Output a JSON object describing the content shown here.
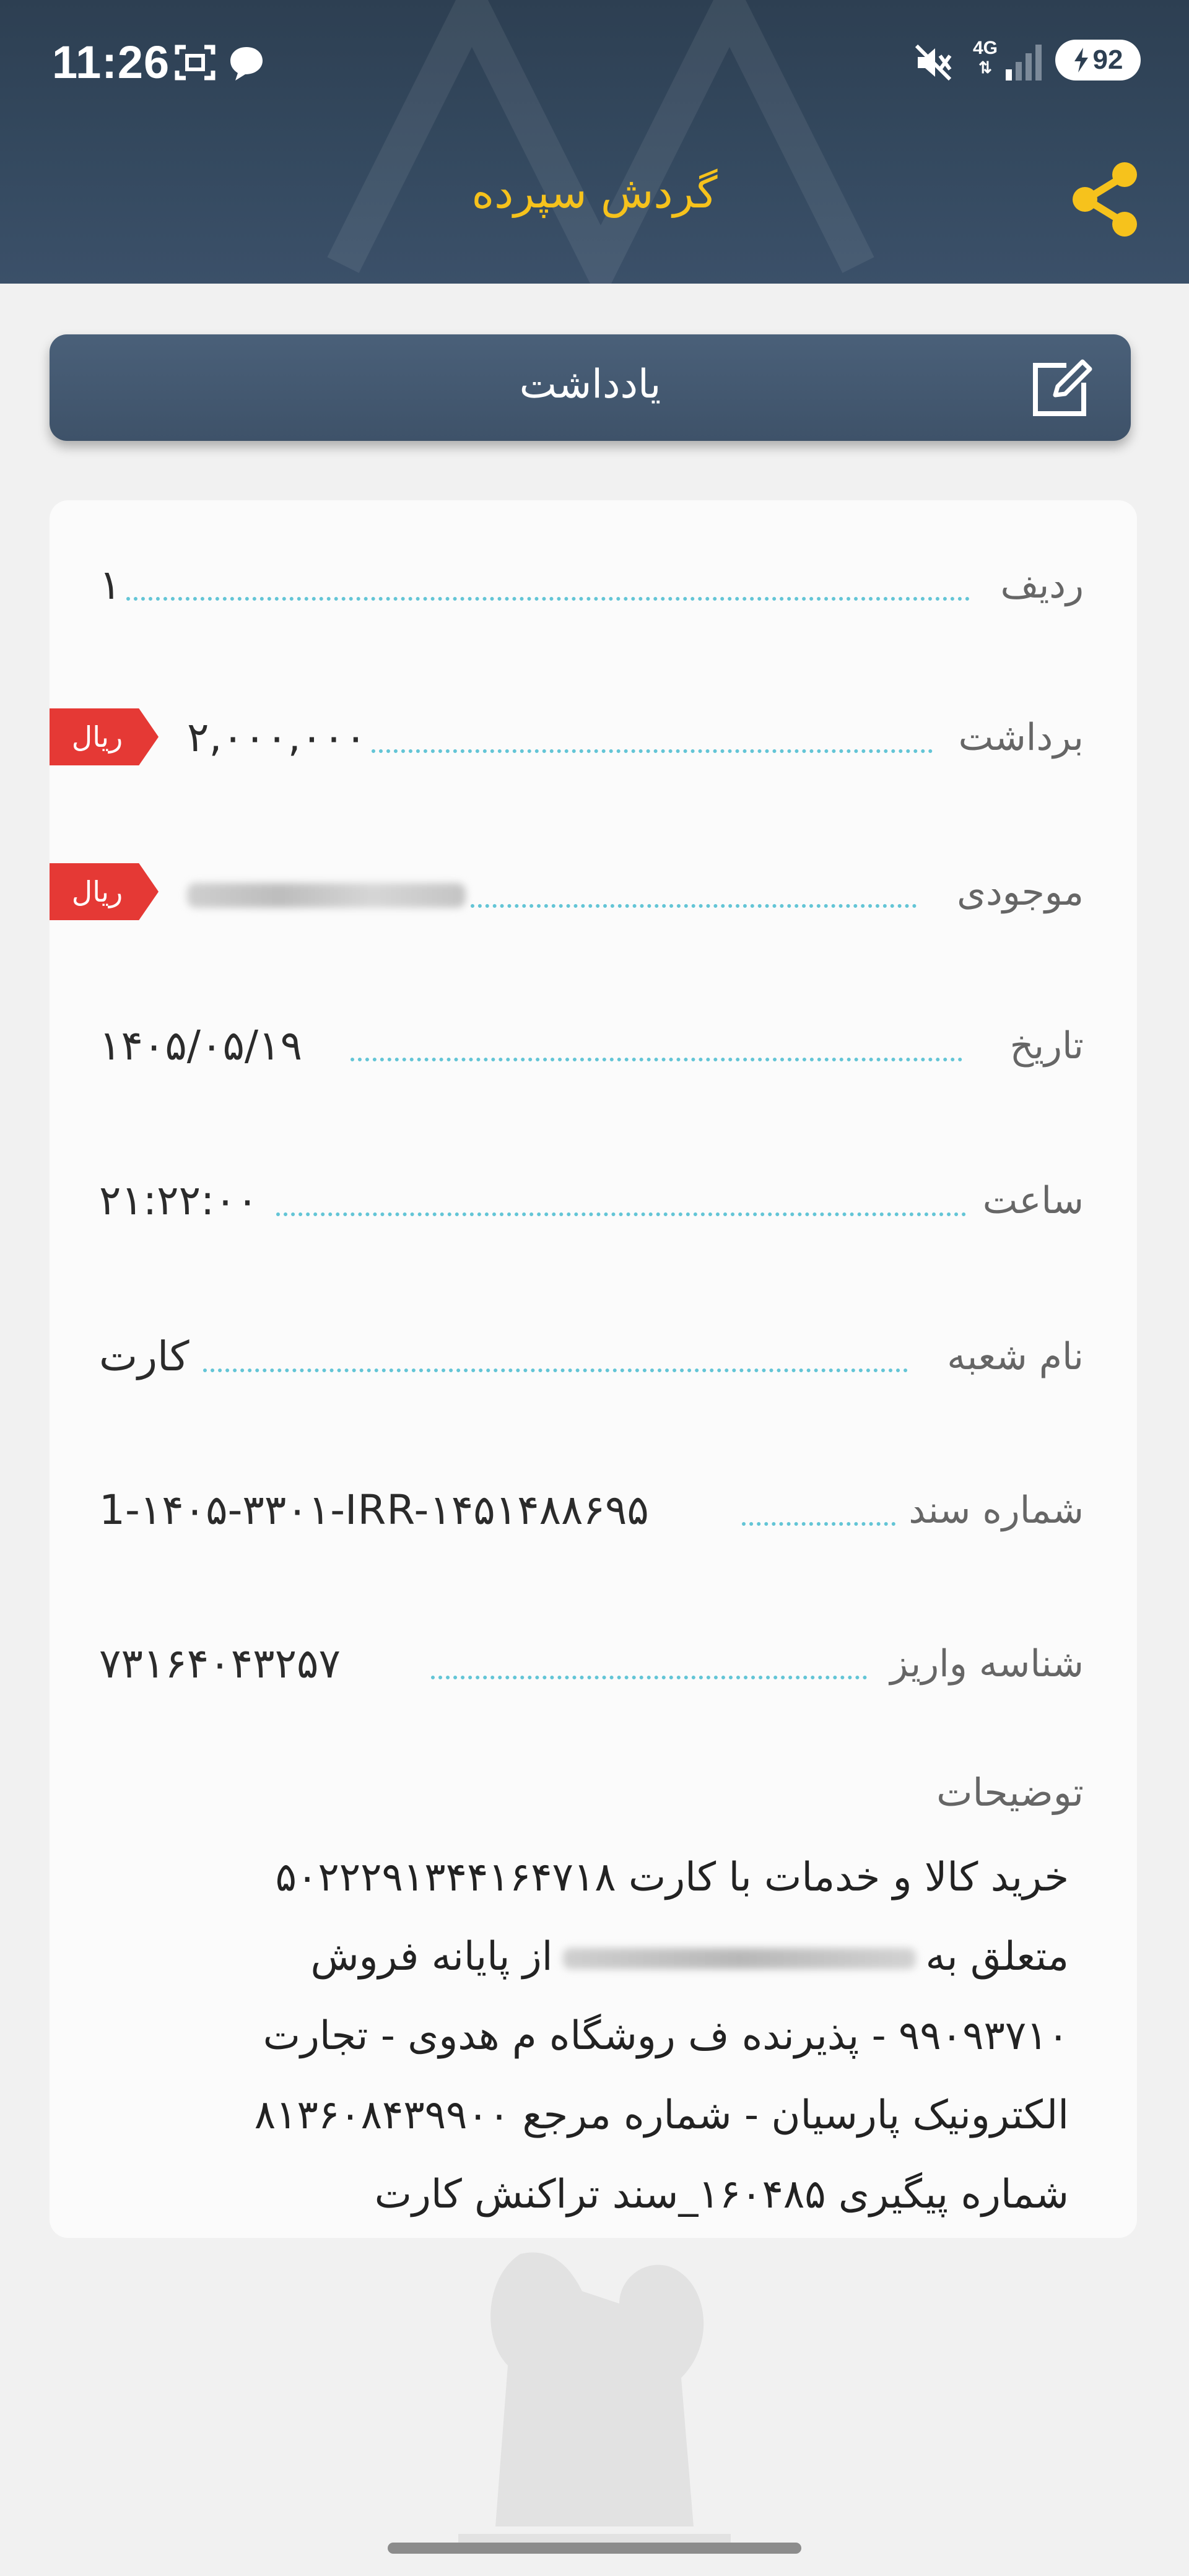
{
  "status_bar": {
    "time": "11:26",
    "network": "4G",
    "battery": "92",
    "icons": [
      "screenshot-icon",
      "chat-icon",
      "mute-icon",
      "signal-icon",
      "charging-icon"
    ]
  },
  "header": {
    "title": "گردش سپرده",
    "share_icon": "share-icon"
  },
  "note_button": {
    "label": "یادداشت",
    "icon": "edit-icon"
  },
  "details": {
    "currency_badge": "ریال",
    "rows": [
      {
        "label": "ردیف",
        "value": "۱"
      },
      {
        "label": "برداشت",
        "value": "۲,۰۰۰,۰۰۰",
        "currency": "ریال"
      },
      {
        "label": "موجودی",
        "value": "",
        "currency": "ریال",
        "redacted": true
      },
      {
        "label": "تاریخ",
        "value": "۱۴۰۵/۰۵/۱۹"
      },
      {
        "label": "ساعت",
        "value": "۲۱:۲۲:۰۰"
      },
      {
        "label": "نام شعبه",
        "value": "کارت"
      },
      {
        "label": "شماره سند",
        "value": "1-۱۴۰۵-۳۳۰۱-IRR-۱۴۵۱۴۸۸۶۹۵"
      },
      {
        "label": "شناسه واریز",
        "value": "۷۳۱۶۴۰۴۳۲۵۷"
      }
    ],
    "description_label": "توضیحات",
    "description_lines": [
      "خرید کالا و خدمات با کارت ۵۰۲۲۲۹۱۳۴۴۱۶۴۷۱۸",
      "متعلق به",
      "از پایانه فروش",
      "۹۹۰۹۳۷۱۰ - پذیرنده ف روشگاه م هدوی - تجارت",
      "الکترونیک پارسیان - شماره مرجع ۸۱۳۶۰۸۴۳۹۹۰۰",
      "شماره پیگیری ۱۶۰۴۸۵_سند تراکنش کارت"
    ]
  },
  "colors": {
    "header_bg": "#2d3f52",
    "title": "#f6c21c",
    "accent_dots": "#63c5d6",
    "badge": "#e53935"
  }
}
